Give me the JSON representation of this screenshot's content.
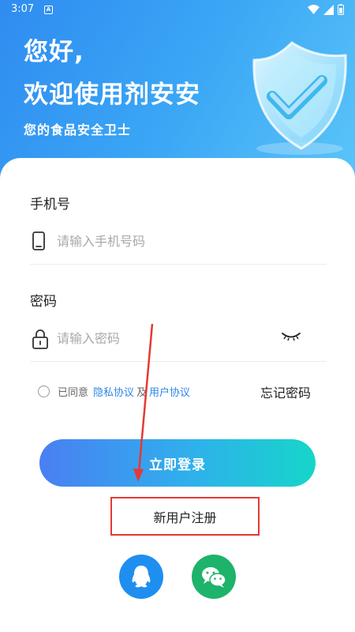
{
  "status_bar": {
    "time": "3:07",
    "notification_badge": "A"
  },
  "header": {
    "greeting_line1": "您好,",
    "greeting_line2": "欢迎使用剂安安",
    "tagline": "您的食品安全卫士"
  },
  "form": {
    "phone": {
      "label": "手机号",
      "placeholder": "请输入手机号码",
      "icon": "phone-icon"
    },
    "password": {
      "label": "密码",
      "placeholder": "请输入密码",
      "icon": "lock-icon",
      "toggle_icon": "eye-closed-icon"
    },
    "agreement": {
      "prefix": "已同意",
      "privacy_link": "隐私协议",
      "conjunction": "及",
      "user_link": "用户协议"
    },
    "forgot_password": "忘记密码",
    "login_button": "立即登录",
    "register_button": "新用户注册"
  },
  "social_login": [
    {
      "name": "qq",
      "icon": "qq-icon",
      "color": "#1e8ff0"
    },
    {
      "name": "wechat",
      "icon": "wechat-icon",
      "color": "#1db36a"
    }
  ],
  "colors": {
    "header_gradient_start": "#2f8cf0",
    "header_gradient_end": "#5cc6f8",
    "button_gradient_start": "#4a7ff2",
    "button_gradient_end": "#16d6c9",
    "link": "#2f86e6",
    "annotation": "#e53935"
  }
}
